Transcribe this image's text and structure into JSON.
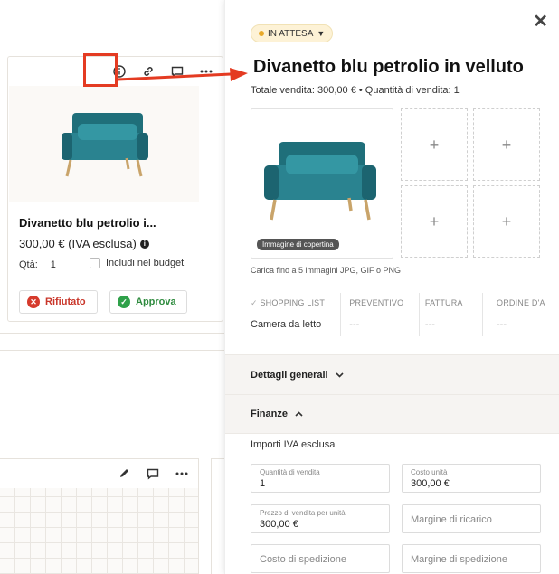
{
  "colors": {
    "accent_red": "#e43b22",
    "reject_red": "#d63a2c",
    "approve_green": "#2fa14a",
    "status_bg": "#fdf2d6",
    "status_dot": "#e8a92a"
  },
  "product_card": {
    "toolbar_icons": [
      "info-icon",
      "link-icon",
      "comment-icon",
      "more-icon"
    ],
    "title": "Divanetto blu petrolio i...",
    "price": "300,00 € (IVA esclusa)",
    "qty_label": "Qtà:",
    "qty_value": "1",
    "budget_label": "Includi nel budget",
    "reject_label": "Rifiutato",
    "approve_label": "Approva"
  },
  "second_card": {
    "toolbar_icons": [
      "pencil-icon",
      "comment-icon",
      "more-icon"
    ]
  },
  "panel": {
    "status": "IN ATTESA",
    "title": "Divanetto blu petrolio in velluto",
    "summary": "Totale vendita: 300,00 € • Quantità di vendita: 1",
    "cover_label": "Immagine di copertina",
    "add_symbol": "+",
    "upload_hint": "Carica fino a 5 immagini JPG, GIF o PNG",
    "steps": [
      {
        "label": "SHOPPING LIST",
        "value": "Camera da letto",
        "done": true
      },
      {
        "label": "PREVENTIVO",
        "value": "---",
        "done": false
      },
      {
        "label": "FATTURA",
        "value": "---",
        "done": false
      },
      {
        "label": "ORDINE D'A",
        "value": "---",
        "done": false
      }
    ],
    "section_general": "Dettagli generali",
    "section_finance": "Finanze",
    "vat_label": "Importi IVA esclusa",
    "fields": {
      "sale_qty": {
        "label": "Quantità di vendita",
        "value": "1"
      },
      "unit_cost": {
        "label": "Costo unità",
        "value": "300,00 €"
      },
      "unit_price": {
        "label": "Prezzo di vendita per unità",
        "value": "300,00 €"
      },
      "markup": {
        "placeholder": "Margine di ricarico"
      },
      "shipping_cost": {
        "placeholder": "Costo di spedizione"
      },
      "shipping_margin": {
        "placeholder": "Margine di spedizione"
      }
    }
  }
}
